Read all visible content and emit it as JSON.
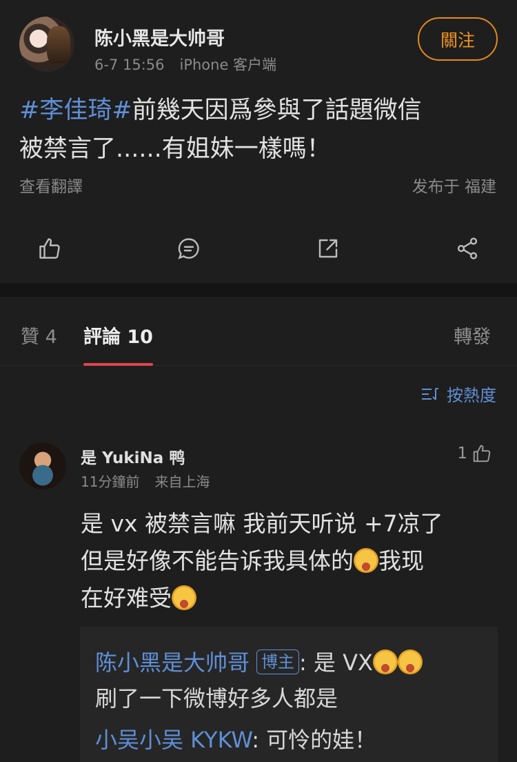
{
  "post": {
    "author": "陈小黑是大帅哥",
    "time": "6-7 15:56",
    "client": "iPhone 客户端",
    "follow_label": "關注",
    "text_tag": "#李佳琦#",
    "text_line1": "前幾天因爲參與了話題微信",
    "text_line2": "被禁言了......有姐妹一樣嗎！",
    "translate": "查看翻譯",
    "location": "发布于 福建"
  },
  "actions": [
    "like-icon",
    "comment-icon",
    "repost-icon",
    "share-icon"
  ],
  "tabs": {
    "likes": "贊 4",
    "comments": "評論 10",
    "reposts": "轉發"
  },
  "sort": {
    "label": "按熱度"
  },
  "comment": {
    "name": "是 YukiNa 鸭",
    "time": "11分鐘前",
    "location": "来自上海",
    "likes": "1",
    "text_a": "是 vx 被禁言嘛 我前天听说 +7凉了",
    "text_b": "但是好像不能告诉我具体的",
    "text_c": "我现",
    "text_d": "在好难受"
  },
  "replies": [
    {
      "who": "陈小黑是大帅哥",
      "badge": "博主",
      "text": ": 是 VX",
      "text2": "刷了一下微博好多人都是"
    },
    {
      "who": "小吴小吴 KYKW",
      "text": ": 可怜的娃！"
    }
  ],
  "colors": {
    "accent_blue": "#5f8fd6",
    "follow_orange": "#f0941f",
    "tab_underline": "#e0454f"
  }
}
